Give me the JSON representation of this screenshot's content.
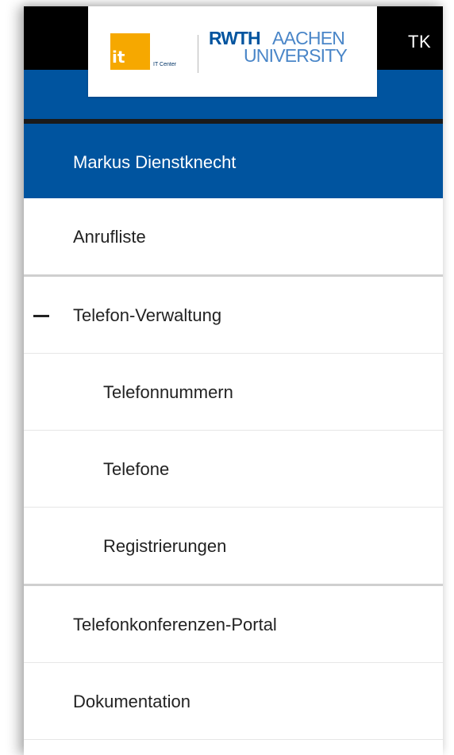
{
  "header": {
    "title": "TK",
    "logo": {
      "it_mark": "it",
      "it_center_label": "IT Center",
      "rwth": "RWTH",
      "aachen": "AACHEN",
      "university": "UNIVERSITY"
    }
  },
  "colors": {
    "rwth_blue": "#00549f",
    "it_orange": "#f6a800",
    "topbar": "#000000"
  },
  "nav": {
    "user": "Markus Dienstknecht",
    "call_list": "Anrufliste",
    "phone_admin": "Telefon-Verwaltung",
    "phone_admin_icon": "collapse-minus-icon",
    "sub_items": [
      "Telefonnummern",
      "Telefone",
      "Registrierungen"
    ],
    "conference_portal": "Telefonkonferenzen-Portal",
    "documentation": "Dokumentation"
  }
}
